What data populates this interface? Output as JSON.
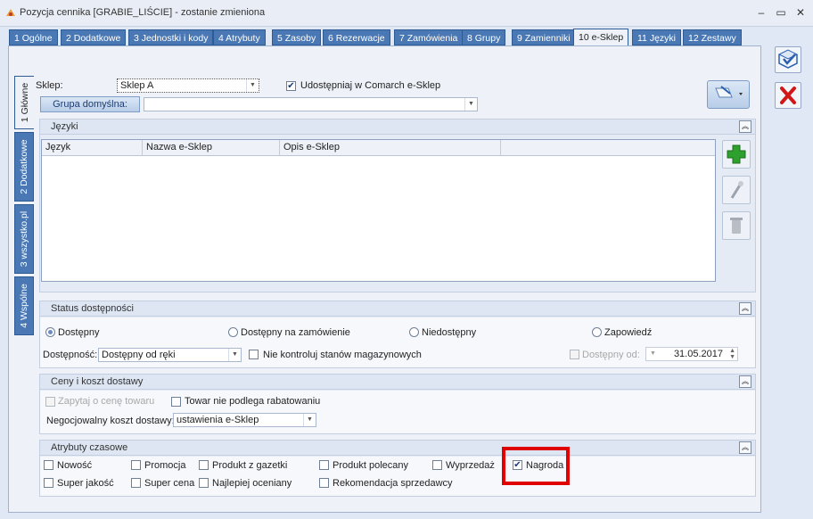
{
  "window": {
    "title": "Pozycja cennika [GRABIE_LIŚCIE] - zostanie zmieniona",
    "minimize": "–",
    "maximize": "▭",
    "close": "✕"
  },
  "top_tabs": [
    {
      "label": "1 Ogólne"
    },
    {
      "label": "2 Dodatkowe"
    },
    {
      "label": "3 Jednostki i kody"
    },
    {
      "label": "4 Atrybuty"
    },
    {
      "label": "5 Zasoby"
    },
    {
      "label": "6 Rezerwacje"
    },
    {
      "label": "7 Zamówienia"
    },
    {
      "label": "8 Grupy"
    },
    {
      "label": "9 Zamienniki"
    },
    {
      "label": "10 e-Sklep"
    },
    {
      "label": "11 Języki"
    },
    {
      "label": "12 Zestawy"
    }
  ],
  "active_top_tab": "10 e-Sklep",
  "side_tabs": [
    {
      "label": "1 Główne"
    },
    {
      "label": "2 Dodatkowe"
    },
    {
      "label": "3 wszystko.pl"
    },
    {
      "label": "4 Wspólne"
    }
  ],
  "form": {
    "shop_label": "Sklep:",
    "shop_value": "Sklep A",
    "share_label": "Udostępniaj w Comarch e-Sklep",
    "share_checked": "✔",
    "default_group_button": "Grupa domyślna:",
    "default_group_value": ""
  },
  "languages": {
    "title": "Języki",
    "columns": [
      "Język",
      "Nazwa e-Sklep",
      "Opis e-Sklep",
      ""
    ]
  },
  "availability": {
    "title": "Status dostępności",
    "options": [
      "Dostępny",
      "Dostępny na zamówienie",
      "Niedostępny",
      "Zapowiedź"
    ],
    "selected": "Dostępny",
    "availability_label": "Dostępność:",
    "availability_value": "Dostępny od ręki",
    "no_stock_control_label": "Nie kontroluj stanów magazynowych",
    "available_from_label": "Dostępny od:",
    "available_from_date": "31.05.2017"
  },
  "prices": {
    "title": "Ceny i koszt dostawy",
    "ask_price_label": "Zapytaj o cenę towaru",
    "no_discount_label": "Towar nie podlega rabatowaniu",
    "shipping_label": "Negocjowalny koszt dostawy:",
    "shipping_value": "ustawienia e-Sklep"
  },
  "attributes": {
    "title": "Atrybuty czasowe",
    "row1": [
      "Nowość",
      "Promocja",
      "Produkt z gazetki",
      "Produkt polecany",
      "Wyprzedaż",
      "Nagroda"
    ],
    "row2": [
      "Super jakość",
      "Super cena",
      "Najlepiej oceniany",
      "Rekomendacja sprzedawcy"
    ],
    "nagroda_checked": "✔"
  },
  "colors": {
    "accent_tab": "#4a78b4",
    "highlight": "#e00000",
    "add_green": "#2ea02e",
    "cancel_red": "#d01818"
  }
}
